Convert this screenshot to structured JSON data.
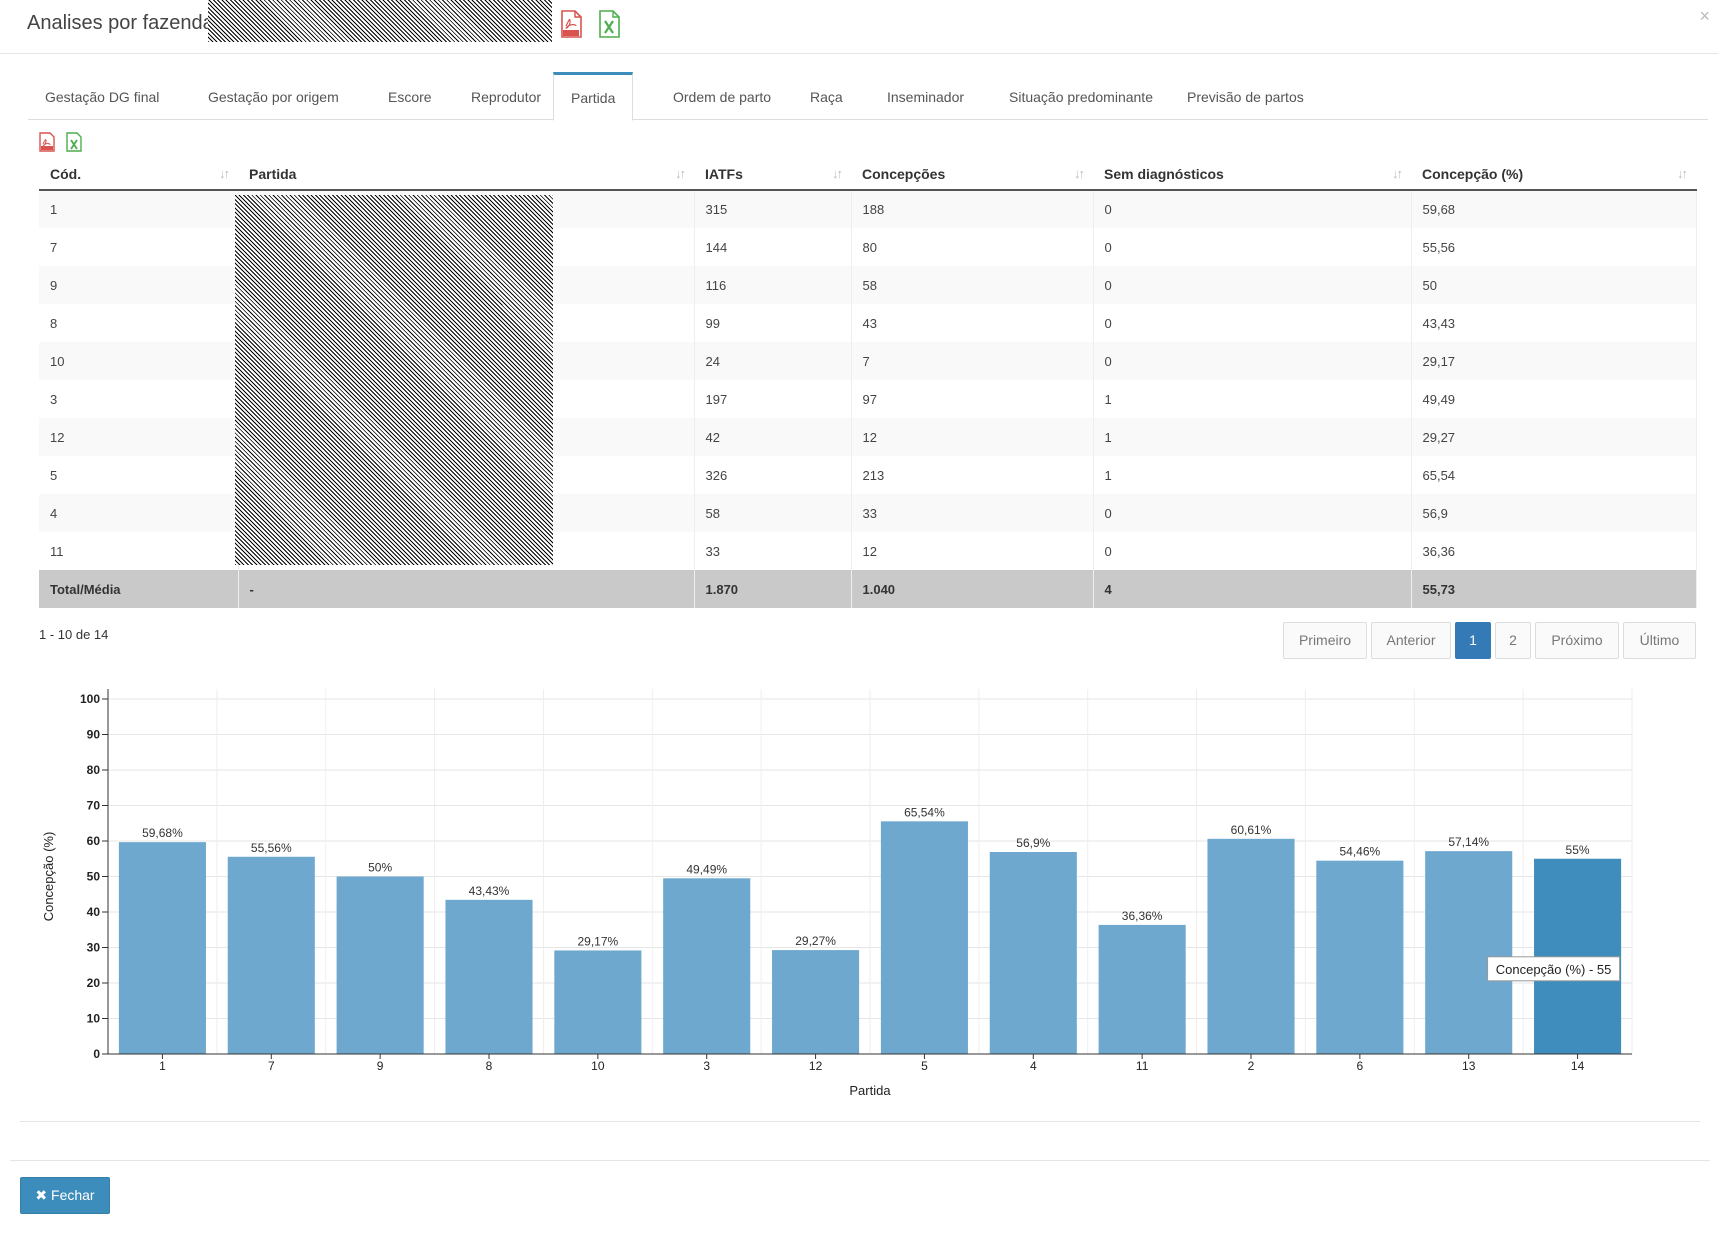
{
  "modal": {
    "title": "Analises por fazendas",
    "close_glyph": "×"
  },
  "header_icons": [
    "pdf-icon",
    "excel-icon"
  ],
  "tabs": [
    {
      "label": "Gestação DG final",
      "active": false
    },
    {
      "label": "Gestação por origem",
      "active": false
    },
    {
      "label": "Escore",
      "active": false
    },
    {
      "label": "Reprodutor",
      "active": false
    },
    {
      "label": "Partida",
      "active": true
    },
    {
      "label": "Ordem de parto",
      "active": false
    },
    {
      "label": "Raça",
      "active": false
    },
    {
      "label": "Inseminador",
      "active": false
    },
    {
      "label": "Situação predominante",
      "active": false
    },
    {
      "label": "Previsão de partos",
      "active": false
    }
  ],
  "table": {
    "columns": [
      "Cód.",
      "Partida",
      "IATFs",
      "Concepções",
      "Sem diagnósticos",
      "Concepção (%)"
    ],
    "rows": [
      [
        "1",
        "",
        "315",
        "188",
        "0",
        "59,68"
      ],
      [
        "7",
        "",
        "144",
        "80",
        "0",
        "55,56"
      ],
      [
        "9",
        "",
        "116",
        "58",
        "0",
        "50"
      ],
      [
        "8",
        "",
        "99",
        "43",
        "0",
        "43,43"
      ],
      [
        "10",
        "",
        "24",
        "7",
        "0",
        "29,17"
      ],
      [
        "3",
        "",
        "197",
        "97",
        "1",
        "49,49"
      ],
      [
        "12",
        "",
        "42",
        "12",
        "1",
        "29,27"
      ],
      [
        "5",
        "",
        "326",
        "213",
        "1",
        "65,54"
      ],
      [
        "4",
        "",
        "58",
        "33",
        "0",
        "56,9"
      ],
      [
        "11",
        "",
        "33",
        "12",
        "0",
        "36,36"
      ]
    ],
    "total": [
      "Total/Média",
      "-",
      "1.870",
      "1.040",
      "4",
      "55,73"
    ]
  },
  "pagination": {
    "range_text": "1 - 10 de 14",
    "first": "Primeiro",
    "prev": "Anterior",
    "pages": [
      "1",
      "2"
    ],
    "current": "1",
    "next": "Próximo",
    "last": "Último"
  },
  "chart_data": {
    "type": "bar",
    "categories": [
      "1",
      "7",
      "9",
      "8",
      "10",
      "3",
      "12",
      "5",
      "4",
      "11",
      "2",
      "6",
      "13",
      "14"
    ],
    "values": [
      59.68,
      55.56,
      50,
      43.43,
      29.17,
      49.49,
      29.27,
      65.54,
      56.9,
      36.36,
      60.61,
      54.46,
      57.14,
      55
    ],
    "data_labels": [
      "59,68%",
      "55,56%",
      "50%",
      "43,43%",
      "29,17%",
      "49,49%",
      "29,27%",
      "65,54%",
      "56,9%",
      "36,36%",
      "60,61%",
      "54,46%",
      "57,14%",
      "55%"
    ],
    "xlabel": "Partida",
    "ylabel": "Concepção (%)",
    "ylim": [
      0,
      100
    ],
    "yticks": [
      0,
      10,
      20,
      30,
      40,
      50,
      60,
      70,
      80,
      90,
      100
    ],
    "grid": true,
    "bar_color": "#6fa8cf",
    "highlight_color": "#3f8dbd",
    "highlighted_category": "14",
    "tooltip": "Concepção (%) - 55"
  },
  "footer": {
    "close_label": "Fechar",
    "close_icon": "times-icon"
  }
}
